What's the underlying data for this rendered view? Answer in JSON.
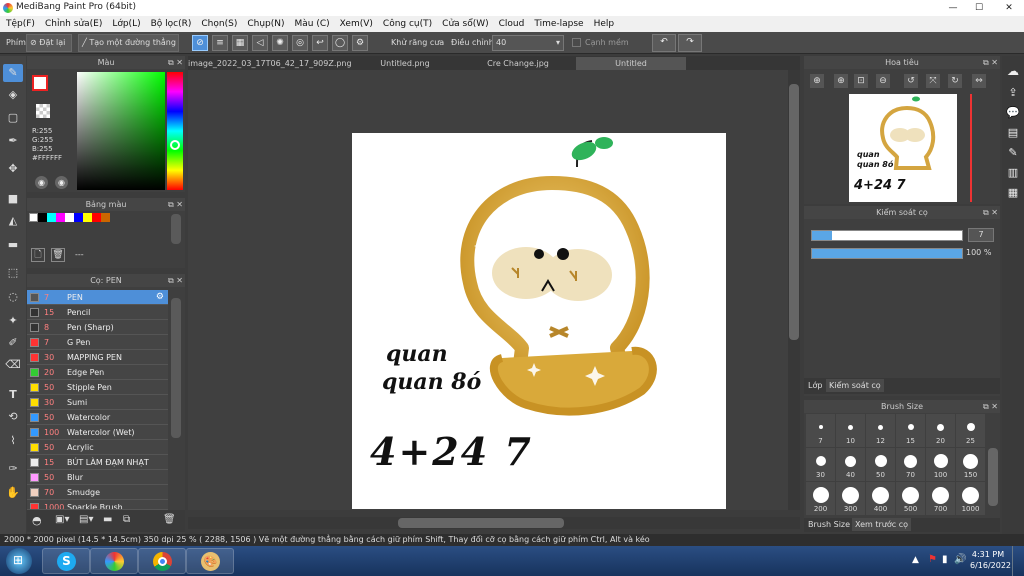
{
  "window": {
    "title": "MediBang Paint Pro (64bit)",
    "min": "—",
    "max": "☐",
    "close": "✕"
  },
  "menu": [
    "Tệp(F)",
    "Chỉnh sửa(E)",
    "Lớp(L)",
    "Bộ lọc(R)",
    "Chọn(S)",
    "Chụp(N)",
    "Màu (C)",
    "Xem(V)",
    "Công cụ(T)",
    "Cửa sổ(W)",
    "Cloud",
    "Time-lapse",
    "Help"
  ],
  "toolbar": {
    "phim": "Phím",
    "reset": "Đặt lại",
    "line": "Tạo một đường thẳng",
    "antialias": "Khử răng cưa",
    "adjust": "Điều chỉnh",
    "adjust_value": "40",
    "edge": "Cạnh mềm"
  },
  "color_panel": {
    "title": "Màu",
    "r": "R:255",
    "g": "G:255",
    "b": "B:255",
    "hex": "#FFFFFF"
  },
  "palette_panel": {
    "title": "Bảng màu",
    "dash": "---"
  },
  "brush_panel": {
    "title": "Cọ: PEN",
    "items": [
      {
        "size": "7",
        "name": "PEN",
        "color": "#555555"
      },
      {
        "size": "15",
        "name": "Pencil",
        "color": "#333333"
      },
      {
        "size": "8",
        "name": "Pen (Sharp)",
        "color": "#333333"
      },
      {
        "size": "7",
        "name": "G Pen",
        "color": "#ff3333"
      },
      {
        "size": "30",
        "name": "MAPPING PEN",
        "color": "#ff3333"
      },
      {
        "size": "20",
        "name": "Edge Pen",
        "color": "#33cc33"
      },
      {
        "size": "50",
        "name": "Stipple Pen",
        "color": "#ffdd00"
      },
      {
        "size": "30",
        "name": "Sumi",
        "color": "#ffdd00"
      },
      {
        "size": "50",
        "name": "Watercolor",
        "color": "#3399ff"
      },
      {
        "size": "100",
        "name": "Watercolor (Wet)",
        "color": "#3399ff"
      },
      {
        "size": "50",
        "name": "Acrylic",
        "color": "#ffdd00"
      },
      {
        "size": "15",
        "name": "BÚT LÀM ĐẠM NHẠT",
        "color": "#eeeeee"
      },
      {
        "size": "50",
        "name": "Blur",
        "color": "#ff99ff"
      },
      {
        "size": "70",
        "name": "Smudge",
        "color": "#f0d0c0"
      },
      {
        "size": "1000",
        "name": "Sparkle Brush",
        "color": "#ff3333"
      }
    ]
  },
  "tabs": [
    "image_2022_03_17T06_42_17_909Z.png",
    "Untitled.png",
    "Cre Change.jpg",
    "Untitled"
  ],
  "navigator": {
    "title": "Hoa tiêu"
  },
  "brush_control": {
    "title": "Kiểm soát cọ",
    "size": "7",
    "opacity": "100 %",
    "opacity_fraction": 1.0,
    "size_fraction": 0.13
  },
  "layer_tabs": {
    "layer": "Lớp",
    "brush_control": "Kiểm soát cọ"
  },
  "brush_size": {
    "title": "Brush Size",
    "sizes": [
      "7",
      "10",
      "12",
      "15",
      "20",
      "25",
      "30",
      "40",
      "50",
      "70",
      "100",
      "150",
      "200",
      "300",
      "400",
      "500",
      "700",
      "1000"
    ]
  },
  "bottom_tabs": {
    "brush_size": "Brush Size",
    "preview": "Xem trước cọ"
  },
  "status": "2000 * 2000 pixel  (14.5 * 14.5cm)  350 dpi  25 %  ( 2288, 1506 )  Vẽ một đường thẳng bằng cách giữ phím Shift, Thay đổi cỡ cọ bằng cách giữ phím Ctrl, Alt và kéo",
  "canvas_text": {
    "line1": "quan",
    "line2": "quan 8ó",
    "line3": "4+24 7"
  },
  "nav_text": {
    "line1": "quan",
    "line2": "quan 8ó",
    "line3": "4+24 7"
  },
  "clock": {
    "time": "4:31 PM",
    "date": "6/16/2022"
  }
}
